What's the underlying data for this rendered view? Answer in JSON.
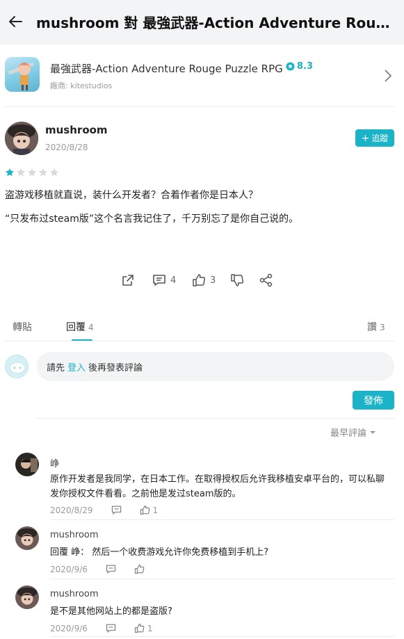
{
  "header": {
    "title": "mushroom 對 最強武器-Action Adventure Rouge Puzzle RPG"
  },
  "app": {
    "name": "最強武器-Action Adventure Rouge Puzzle RPG",
    "rating": "8.3",
    "developer": "廠商:  kitestudios"
  },
  "post": {
    "author": "mushroom",
    "date": "2020/8/28",
    "follow_label": "追蹤",
    "stars_filled": 1,
    "stars_total": 5,
    "paragraphs": [
      "盗游戏移植就直说，装什么开发者？合着作者你是日本人？",
      "“只发布过steam版”这个名言我记住了，千万别忘了是你自己说的。"
    ],
    "comment_count": "4",
    "like_count": "3"
  },
  "tabs": {
    "repost": "轉貼",
    "reply": "回覆",
    "reply_count": "4",
    "likes": "讚",
    "likes_count": "3"
  },
  "comment_box": {
    "prefix": "請先",
    "login": "登入",
    "suffix": "後再發表評論",
    "publish_label": "發佈"
  },
  "sort": {
    "label": "最早評論"
  },
  "replies": [
    {
      "author": "峥",
      "text": "原作开发者是我同学，在日本工作。在取得授权后允许我移植安卓平台的，可以私聊发你授权文件看看。之前他是发过steam版的。",
      "date": "2020/8/29",
      "likes": "1"
    },
    {
      "author": "mushroom",
      "text": "回覆 峥：  然后一个收费游戏允许你免费移植到手机上?",
      "date": "2020/9/6",
      "likes": ""
    },
    {
      "author": "mushroom",
      "text": "是不是其他网站上的都是盗版?",
      "date": "2020/9/6",
      "likes": "1"
    }
  ],
  "colors": {
    "accent": "#1ab3c7",
    "header_bg": "#f3f4f6"
  }
}
